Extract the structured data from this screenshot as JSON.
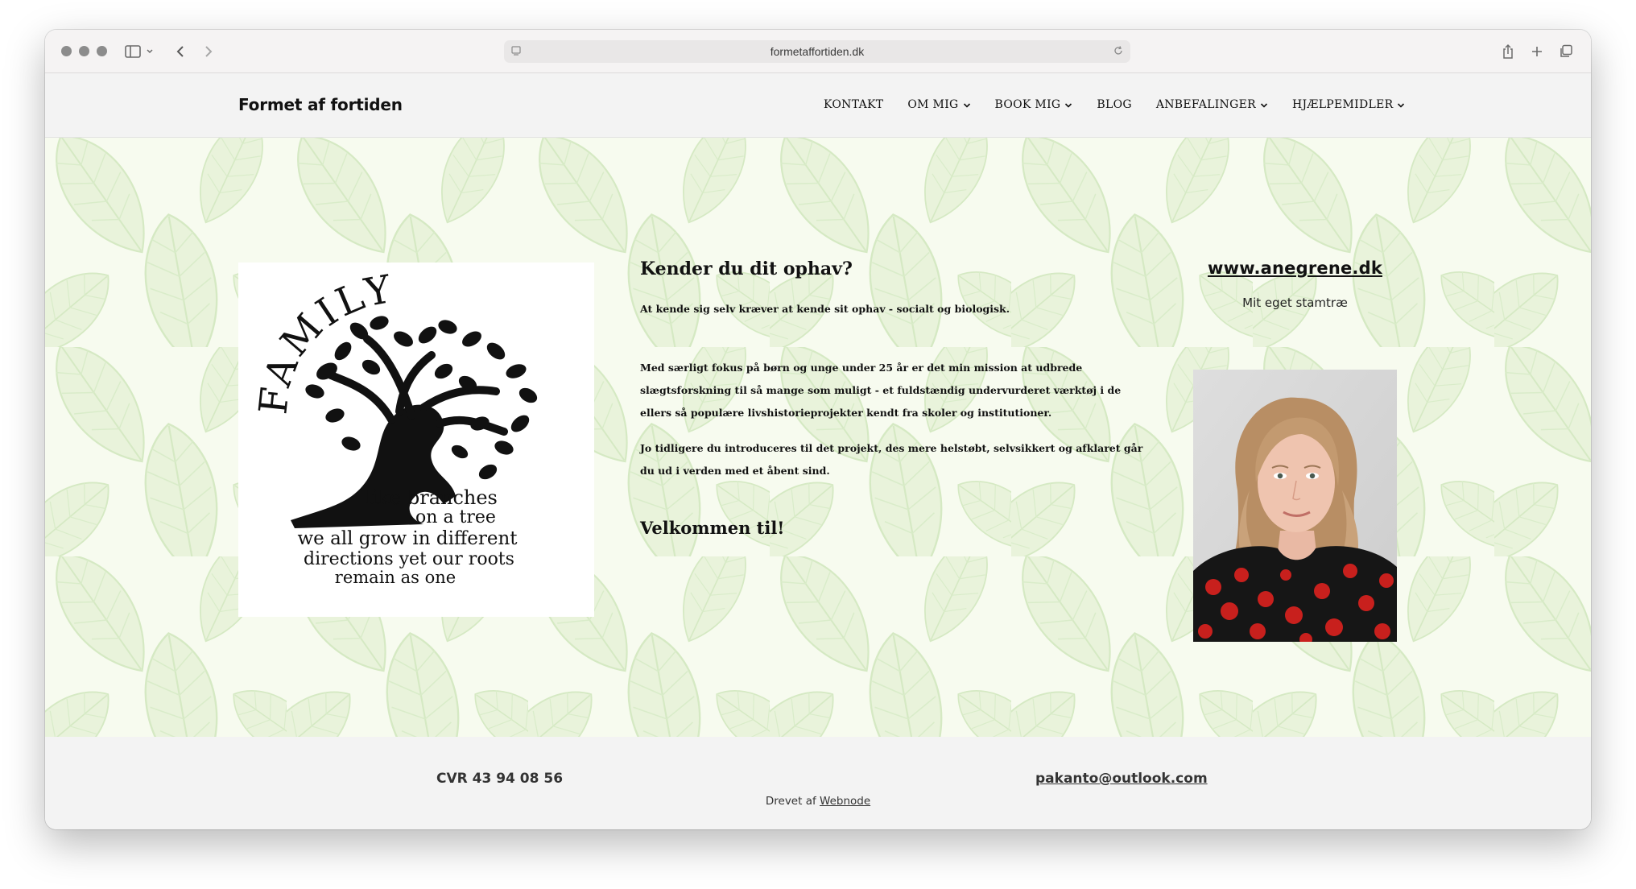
{
  "browser": {
    "url": "formetaffortiden.dk"
  },
  "header": {
    "brand": "Formet af fortiden",
    "nav": [
      {
        "label": "KONTAKT",
        "dropdown": false
      },
      {
        "label": "OM MIG",
        "dropdown": true
      },
      {
        "label": "BOOK MIG",
        "dropdown": true
      },
      {
        "label": "BLOG",
        "dropdown": false
      },
      {
        "label": "ANBEFALINGER",
        "dropdown": true
      },
      {
        "label": "HJÆLPEMIDLER",
        "dropdown": true
      }
    ]
  },
  "logo": {
    "word": "FAMILY",
    "line1": "like branches",
    "line2": "on a tree",
    "line3": "we all grow in different",
    "line4": "directions yet our roots",
    "line5": "remain as one"
  },
  "main": {
    "heading": "Kender du dit ophav?",
    "p1": "At kende sig selv kræver at kende sit ophav - socialt og biologisk.",
    "p2": "Med særligt fokus på børn og unge under 25 år er det min mission at udbrede slægtsforskning til så mange som muligt - et fuldstændig undervurderet værktøj i de ellers så populære livshistorieprojekter kendt fra skoler og institutioner.",
    "p3": "Jo tidligere du introduceres til det projekt, des mere helstøbt, selvsikkert og afklaret går du ud i verden med et åbent sind.",
    "welcome": "Velkommen til!"
  },
  "sidebar": {
    "link": "www.anegrene.dk",
    "caption": "Mit eget stamtræ"
  },
  "footer": {
    "cvr": "CVR 43 94 08 56",
    "email": "pakanto@outlook.com",
    "powered_prefix": "Drevet af",
    "powered_link": "Webnode"
  },
  "colors": {
    "leaf_light": "#e3f1d3",
    "leaf_line": "#cfe6bb",
    "hero_bg": "#f6fbee"
  }
}
